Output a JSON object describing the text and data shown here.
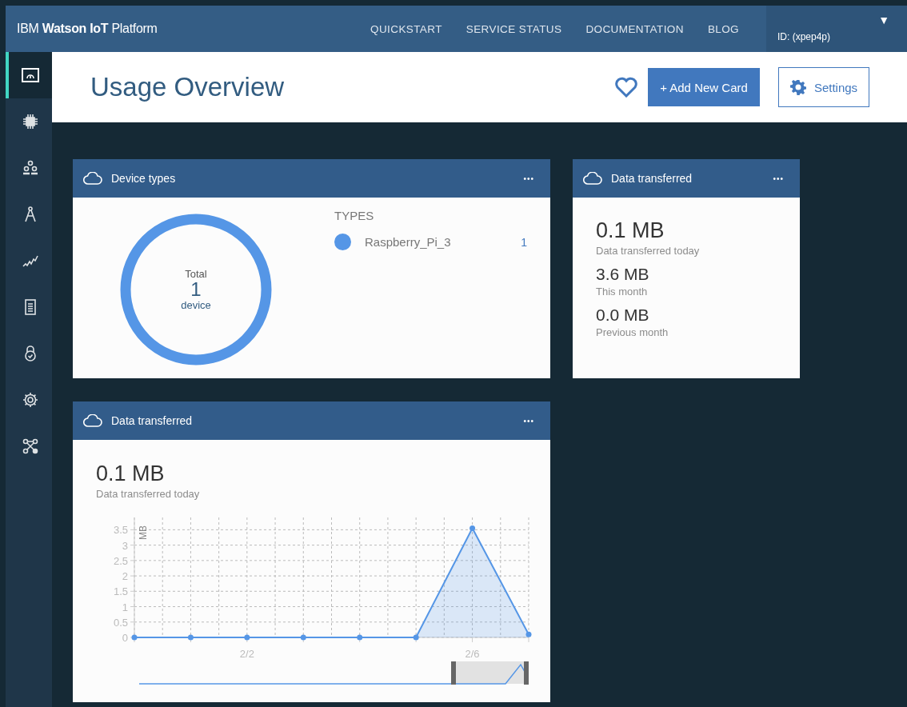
{
  "header": {
    "brand": "IBM **Watson IoT** Platform",
    "nav": [
      "QUICKSTART",
      "SERVICE STATUS",
      "DOCUMENTATION",
      "BLOG"
    ],
    "account": {
      "caret": "▼",
      "id": "ID: (xpep4p)"
    }
  },
  "sidebar": {
    "items": [
      {
        "selected": true
      },
      {
        "selected": false
      },
      {
        "selected": false
      },
      {
        "selected": false
      },
      {
        "selected": false
      },
      {
        "selected": false
      },
      {
        "selected": false
      },
      {
        "selected": false
      },
      {
        "selected": false
      }
    ]
  },
  "page": {
    "title": "Usage Overview",
    "add_button": "+ Add New Card",
    "settings_button": "Settings"
  },
  "device_types_card": {
    "title": "Device types",
    "menu": "•••",
    "total_label": "Total",
    "total": "1",
    "unit": "device",
    "types_heading": "TYPES",
    "types": [
      {
        "name": "Raspberry_Pi_3",
        "count": "1",
        "color": "#5596e6"
      }
    ]
  },
  "data_card": {
    "title": "Data transferred",
    "menu": "•••",
    "stats": [
      {
        "value": "0.1 MB",
        "label": "Data transferred today"
      },
      {
        "value": "3.6 MB",
        "label": "This month"
      },
      {
        "value": "0.0 MB",
        "label": "Previous month"
      }
    ]
  },
  "chart_card": {
    "title": "Data transferred",
    "menu": "•••",
    "value": "0.1 MB",
    "label": "Data transferred today",
    "chart_data": {
      "type": "area",
      "ylabel": "MB",
      "categories": [
        null,
        null,
        "2/2",
        null,
        null,
        null,
        "2/6",
        null
      ],
      "series": [
        {
          "color": "#5596e6",
          "values": [
            0,
            0,
            0,
            0,
            0,
            0,
            3.55,
            0.1
          ]
        }
      ],
      "ylim": [
        0,
        3.9
      ],
      "grid": true,
      "yticks": [
        0,
        0.5,
        1,
        1.5,
        2,
        2.5,
        3,
        3.5
      ]
    }
  }
}
